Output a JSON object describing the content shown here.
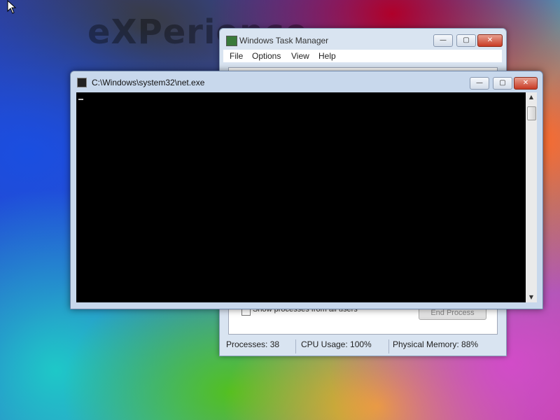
{
  "desktop": {
    "watermark": "eXPerience"
  },
  "taskmanager": {
    "title": "Windows Task Manager",
    "menu": [
      "File",
      "Options",
      "View",
      "Help"
    ],
    "show_all_label": "Show processes from all users",
    "end_process_label": "End Process",
    "status": {
      "processes": "Processes: 38",
      "cpu": "CPU Usage: 100%",
      "memory": "Physical Memory: 88%"
    }
  },
  "console": {
    "title": "C:\\Windows\\system32\\net.exe"
  },
  "controls": {
    "minimize": "—",
    "maximize": "▢",
    "close": "✕"
  },
  "icons": {
    "cursor": "arrow-cursor-icon",
    "scroll_up": "▲",
    "scroll_down": "▼"
  }
}
